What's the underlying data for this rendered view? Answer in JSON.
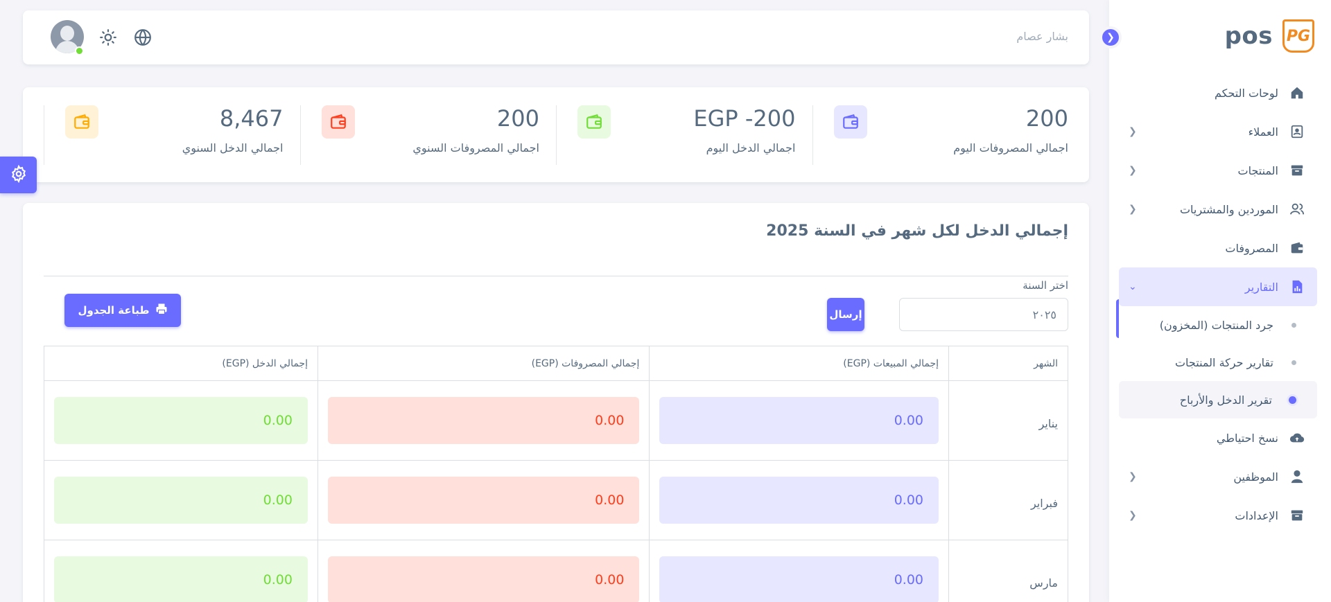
{
  "brand": {
    "name": "pos",
    "logo_text": "PG"
  },
  "sidebar": {
    "items": [
      {
        "label": "لوحات التحكم",
        "icon": "home-icon",
        "chevron": false
      },
      {
        "label": "العملاء",
        "icon": "contacts-icon",
        "chevron": true
      },
      {
        "label": "المنتجات",
        "icon": "archive-icon",
        "chevron": true
      },
      {
        "label": "الموردين والمشتريات",
        "icon": "users-icon",
        "chevron": true
      },
      {
        "label": "المصروفات",
        "icon": "wallet-icon",
        "chevron": false
      },
      {
        "label": "التقارير",
        "icon": "report-icon",
        "chevron": true,
        "active": true
      }
    ],
    "sub_items": [
      {
        "label": "جرد المنتجات (المخزون)"
      },
      {
        "label": "تقارير حركة المنتجات"
      },
      {
        "label": "تقرير الدخل والأرباح",
        "active": true
      }
    ],
    "items_after": [
      {
        "label": "نسخ احتياطي",
        "icon": "cloud-upload-icon",
        "chevron": false
      },
      {
        "label": "الموظفين",
        "icon": "user-icon",
        "chevron": true
      },
      {
        "label": "الإعدادات",
        "icon": "archive-icon",
        "chevron": true
      }
    ]
  },
  "navbar": {
    "user_name": "بشار عصام"
  },
  "stats": [
    {
      "value": "200",
      "label": "اجمالي المصروفات اليوم",
      "color": "#696cff",
      "bg": "#e7e7ff"
    },
    {
      "value": "EGP -200",
      "label": "اجمالي الدخل اليوم",
      "color": "#71dd37",
      "bg": "#e8fadf"
    },
    {
      "value": "200",
      "label": "اجمالي المصروفات السنوي",
      "color": "#ff3e1d",
      "bg": "#ffe0db"
    },
    {
      "value": "8,467",
      "label": "اجمالي الدخل السنوي",
      "color": "#ffab00",
      "bg": "#fff2d6"
    }
  ],
  "report": {
    "title": "إجمالي الدخل لكل شهر في السنة 2025",
    "year_label": "اختر السنة",
    "year_value": "٢٠٢٥",
    "send_label": "إرسال",
    "print_label": "طباعة الجدول",
    "columns": [
      "الشهر",
      "إجمالي المبيعات (EGP)",
      "إجمالي المصروفات (EGP)",
      "إجمالي الدخل (EGP)"
    ],
    "rows": [
      {
        "month": "يناير",
        "sales": "0.00",
        "expenses": "0.00",
        "income": "0.00"
      },
      {
        "month": "فبراير",
        "sales": "0.00",
        "expenses": "0.00",
        "income": "0.00"
      },
      {
        "month": "مارس",
        "sales": "0.00",
        "expenses": "0.00",
        "income": "0.00"
      }
    ]
  },
  "colors": {
    "primary": "#696cff",
    "brand_orange": "#f18a1f"
  }
}
